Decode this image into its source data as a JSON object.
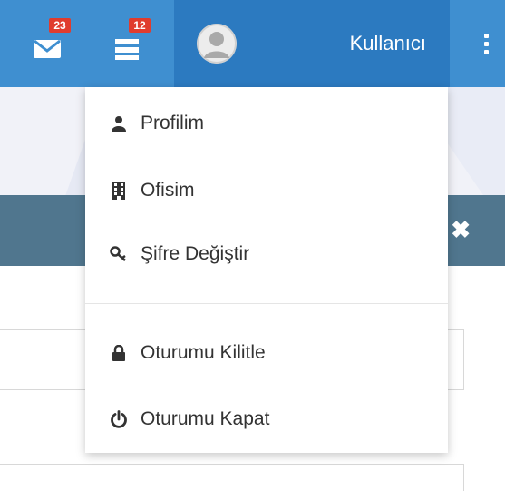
{
  "colors": {
    "navbar": "#3f8fd0",
    "user_area": "#2c7ac0",
    "badge": "#e03c2e",
    "panel_header": "#50768e",
    "menu_text": "#333333"
  },
  "navbar": {
    "mail": {
      "icon": "envelope-icon",
      "badge": "23"
    },
    "tasks": {
      "icon": "tasks-icon",
      "badge": "12"
    },
    "user": {
      "avatar_icon": "user-avatar-icon",
      "name": "Kullanıcı"
    },
    "more_icon": "vertical-dots-icon"
  },
  "dropdown": {
    "items": [
      {
        "icon": "user-icon",
        "label": "Profilim"
      },
      {
        "icon": "building-icon",
        "label": "Ofisim"
      },
      {
        "icon": "key-icon",
        "label": "Şifre Değiştir"
      },
      {
        "icon": "lock-icon",
        "label": "Oturumu Kilitle"
      },
      {
        "icon": "power-icon",
        "label": "Oturumu Kapat"
      }
    ]
  },
  "panel": {
    "close_icon": "close-icon",
    "close_symbol": "✖"
  }
}
